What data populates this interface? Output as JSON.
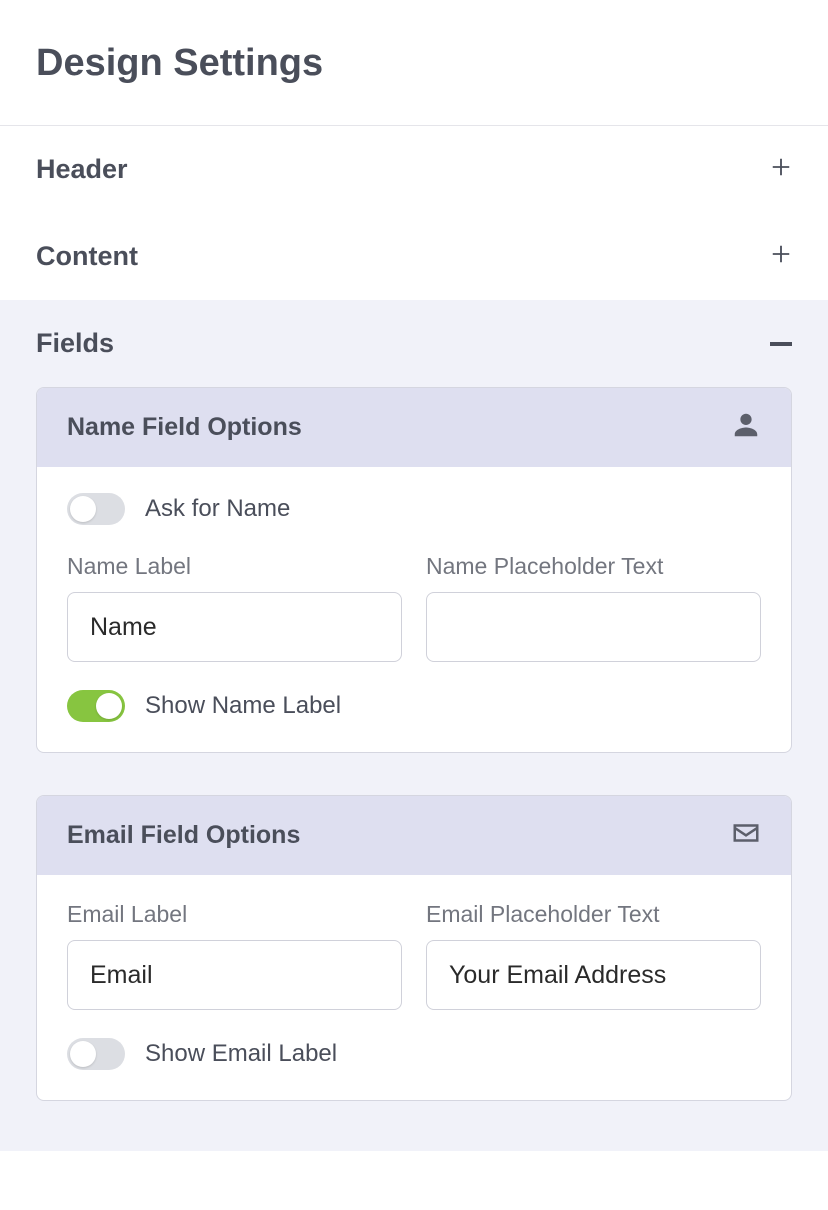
{
  "page": {
    "title": "Design Settings"
  },
  "sections": {
    "header": {
      "label": "Header",
      "expanded": false
    },
    "content": {
      "label": "Content",
      "expanded": false
    },
    "fields": {
      "label": "Fields",
      "expanded": true
    }
  },
  "nameCard": {
    "title": "Name Field Options",
    "askForName": {
      "label": "Ask for Name",
      "on": false
    },
    "nameLabelField": {
      "label": "Name Label",
      "value": "Name"
    },
    "namePlaceholderField": {
      "label": "Name Placeholder Text",
      "value": ""
    },
    "showNameLabel": {
      "label": "Show Name Label",
      "on": true
    }
  },
  "emailCard": {
    "title": "Email Field Options",
    "emailLabelField": {
      "label": "Email Label",
      "value": "Email"
    },
    "emailPlaceholderField": {
      "label": "Email Placeholder Text",
      "value": "Your Email Address"
    },
    "showEmailLabel": {
      "label": "Show Email Label",
      "on": false
    }
  }
}
